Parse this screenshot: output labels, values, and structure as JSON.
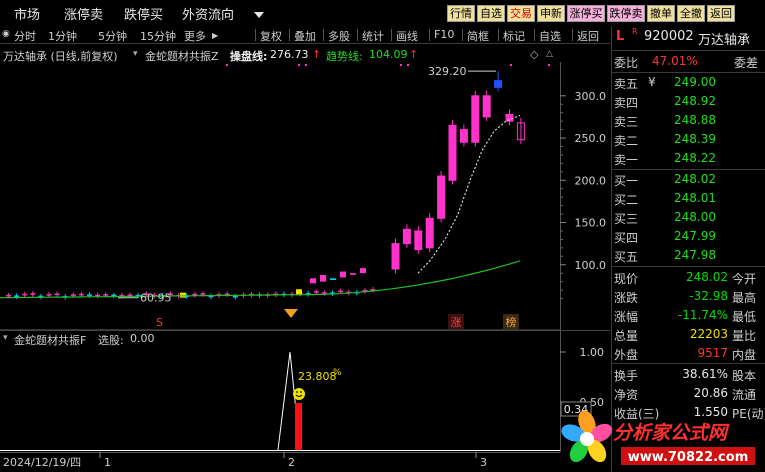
{
  "menu": [
    {
      "label": "市场"
    },
    {
      "label": "涨停卖"
    },
    {
      "label": "跌停买"
    },
    {
      "label": "外资流向"
    }
  ],
  "quick_buttons": [
    {
      "label": "行情",
      "bg": "#f0e0a0",
      "fg": "#000000"
    },
    {
      "label": "自选",
      "bg": "#f0e0a0",
      "fg": "#000000"
    },
    {
      "label": "交易",
      "bg": "#f0e0a0",
      "fg": "#d00000"
    },
    {
      "label": "申新",
      "bg": "#f0e0a0",
      "fg": "#000000"
    },
    {
      "label": "涨停买",
      "bg": "#f4b0d8",
      "fg": "#000000"
    },
    {
      "label": "跌停卖",
      "bg": "#f4b0d8",
      "fg": "#000000"
    },
    {
      "label": "撤单",
      "bg": "#f0e0a0",
      "fg": "#000000"
    },
    {
      "label": "全撤",
      "bg": "#f0e0a0",
      "fg": "#000000"
    },
    {
      "label": "返回",
      "bg": "#f0e0a0",
      "fg": "#000000"
    }
  ],
  "toolbar": {
    "left": [
      "分时",
      "1分钟",
      "5分钟",
      "15分钟",
      "更多"
    ],
    "right": [
      "复权",
      "叠加",
      "多股",
      "统计",
      "画线",
      "F10",
      "简框",
      "标记",
      "自选",
      "返回"
    ]
  },
  "info": {
    "stock": "万达轴承 (日线,前复权)",
    "indicator": "金蛇题材共振Z",
    "line1_label": "操盘线:",
    "line1_value": "276.73",
    "line2_label": "趋势线:",
    "line2_value": "104.09"
  },
  "sub_indicator": {
    "name": "金蛇题材共振F",
    "value_label": "选股:",
    "value": "0.00",
    "peak_label": "23.808",
    "peak_pct": "%"
  },
  "main_chart": {
    "annotations": {
      "high": "329.20",
      "low": "60.95",
      "tag_zhang": "涨",
      "tag_bang": "榜"
    },
    "yticks": [
      "300.0",
      "250.0",
      "200.0",
      "150.0",
      "100.0"
    ]
  },
  "sub_chart": {
    "yticks": [
      "1.00",
      "0.50"
    ],
    "corner_value": "0.34"
  },
  "xaxis": {
    "date": "2024/12/19/四",
    "marks": [
      "1",
      "2",
      "3"
    ]
  },
  "chart_data": {
    "type": "candlestick",
    "series": [
      {
        "name": "操盘线",
        "last": 276.73
      },
      {
        "name": "趋势线",
        "last": 104.09
      }
    ],
    "high_annotation": 329.2,
    "low_annotation": 60.95,
    "ylim": [
      50,
      340
    ],
    "candles_late": [
      {
        "o": 95,
        "c": 125
      },
      {
        "o": 125,
        "c": 142
      },
      {
        "o": 140,
        "c": 118
      },
      {
        "o": 120,
        "c": 155
      },
      {
        "o": 155,
        "c": 205
      },
      {
        "o": 200,
        "c": 265
      },
      {
        "o": 260,
        "c": 245
      },
      {
        "o": 245,
        "c": 300
      },
      {
        "o": 300,
        "c": 275
      },
      {
        "o": 310,
        "c": 318
      },
      {
        "o": 278,
        "c": 270
      },
      {
        "o": 268,
        "c": 248
      }
    ]
  },
  "quote": {
    "header_flag": "L",
    "header_r": "R",
    "code": "920002",
    "name": "万达轴承",
    "wei_bi_label": "委比",
    "wei_bi": "47.01%",
    "wei_cha_label": "委差",
    "asks": [
      {
        "label": "卖五",
        "mark": "¥",
        "price": "249.00"
      },
      {
        "label": "卖四",
        "mark": "",
        "price": "248.92"
      },
      {
        "label": "卖三",
        "mark": "",
        "price": "248.88"
      },
      {
        "label": "卖二",
        "mark": "",
        "price": "248.39"
      },
      {
        "label": "卖一",
        "mark": "",
        "price": "248.22"
      }
    ],
    "bids": [
      {
        "label": "买一",
        "price": "248.02"
      },
      {
        "label": "买二",
        "price": "248.01"
      },
      {
        "label": "买三",
        "price": "248.00"
      },
      {
        "label": "买四",
        "price": "247.99"
      },
      {
        "label": "买五",
        "price": "247.98"
      }
    ],
    "stats": [
      {
        "label": "现价",
        "value": "248.02",
        "color": "#00dd00",
        "right": "今开"
      },
      {
        "label": "涨跌",
        "value": "-32.98",
        "color": "#00dd00",
        "right": "最高"
      },
      {
        "label": "涨幅",
        "value": "-11.74%",
        "color": "#00dd00",
        "right": "最低"
      },
      {
        "label": "总量",
        "value": "22203",
        "color": "#f0e000",
        "right": "量比"
      },
      {
        "label": "外盘",
        "value": "9517",
        "color": "#ff3333",
        "right": "内盘"
      }
    ],
    "stats2": [
      {
        "label": "换手",
        "value": "38.61%",
        "right": "股本"
      },
      {
        "label": "净资",
        "value": "20.86",
        "right": "流通"
      },
      {
        "label": "收益(三)",
        "value": "1.550",
        "right": "PE(动)"
      }
    ]
  },
  "watermark": {
    "title": "分析家公式网",
    "url": "www.70822.com"
  },
  "colors": {
    "up": "#ff33cc",
    "down": "#00dd00",
    "ma_dashed": "#ffffff",
    "trend": "#1fbf1f",
    "accent_yellow": "#f0e000",
    "red": "#ff2020"
  }
}
